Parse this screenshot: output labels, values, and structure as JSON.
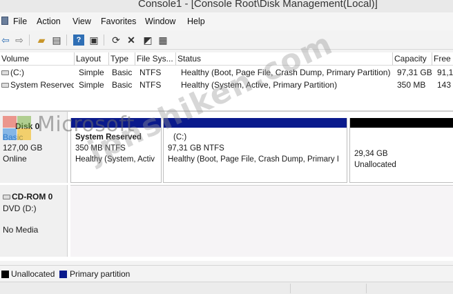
{
  "window": {
    "title": "Console1 - [Console Root\\Disk Management(Local)]"
  },
  "menu": [
    "File",
    "Action",
    "View",
    "Favorites",
    "Window",
    "Help"
  ],
  "toolbar": [
    "back-arrow-icon",
    "forward-arrow-icon",
    "up-folder-icon",
    "show-hide-tree-icon",
    "help-icon",
    "properties-icon",
    "refresh-icon",
    "delete-icon",
    "connect-icon",
    "settings-icon"
  ],
  "volumes": {
    "columns": [
      "Volume",
      "Layout",
      "Type",
      "File Sys...",
      "Status",
      "Capacity",
      "Free"
    ],
    "rows": [
      [
        "(C:)",
        "Simple",
        "Basic",
        "NTFS",
        "Healthy (Boot, Page File, Crash Dump, Primary Partition)",
        "97,31 GB",
        "91,1("
      ],
      [
        "System Reserved",
        "Simple",
        "Basic",
        "NTFS",
        "Healthy (System, Active, Primary Partition)",
        "350 MB",
        "143 I"
      ]
    ]
  },
  "disks": [
    {
      "name": "Disk 0",
      "type": "Basic",
      "size": "127,00 GB",
      "state": "Online",
      "partitions": [
        {
          "title": "System Reserved",
          "size": "350 MB NTFS",
          "status": "Healthy (System, Activ",
          "bar_color": "#0a1a8c"
        },
        {
          "title": "(C:)",
          "size": "97,31 GB NTFS",
          "status": "Healthy (Boot, Page File, Crash Dump, Primary I",
          "bar_color": "#0a1a8c"
        },
        {
          "title": "",
          "size": "29,34 GB",
          "status": "Unallocated",
          "bar_color": "#000000"
        }
      ]
    },
    {
      "name": "CD-ROM 0",
      "type": "DVD (D:)",
      "state": "No Media"
    }
  ],
  "legend": [
    {
      "label": "Unallocated",
      "color": "#000000"
    },
    {
      "label": "Primary partition",
      "color": "#0a1a8c"
    }
  ],
  "watermarks": {
    "logo_text": "Microsoft",
    "site": "jpnshiken.com"
  }
}
